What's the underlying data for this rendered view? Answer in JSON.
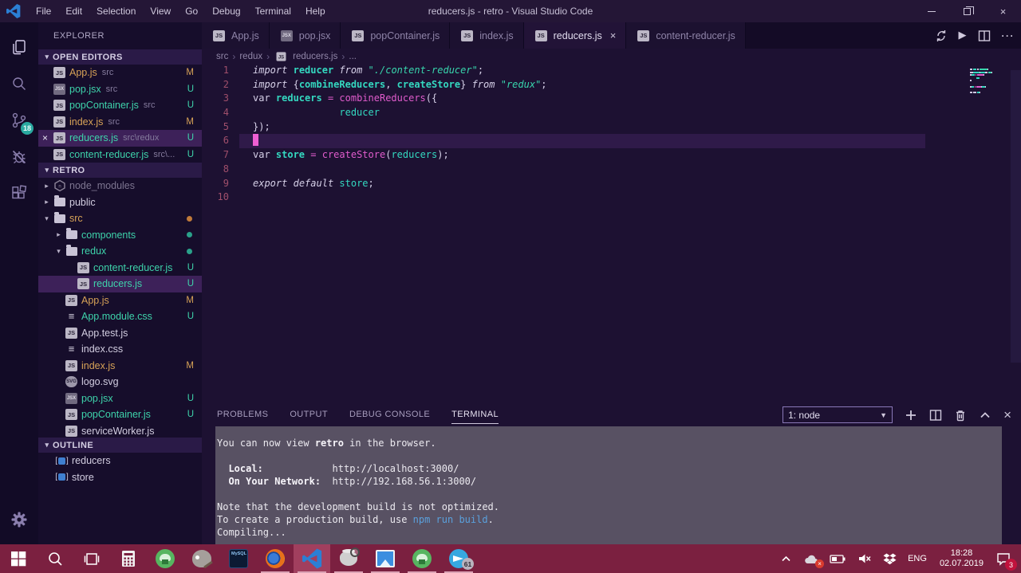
{
  "title_bar": {
    "title": "reducers.js - retro - Visual Studio Code",
    "menus": [
      "File",
      "Edit",
      "Selection",
      "View",
      "Go",
      "Debug",
      "Terminal",
      "Help"
    ]
  },
  "activity_bar": {
    "items": [
      {
        "icon": "files",
        "name": "explorer",
        "active": true
      },
      {
        "icon": "search",
        "name": "search"
      },
      {
        "icon": "source-control",
        "name": "source-control",
        "badge": "18"
      },
      {
        "icon": "debug",
        "name": "debug"
      },
      {
        "icon": "extensions",
        "name": "extensions"
      }
    ],
    "bottom_icon": "settings-gear"
  },
  "sidebar": {
    "title": "EXPLORER",
    "open_editors": {
      "header": "OPEN EDITORS",
      "items": [
        {
          "label": "App.js",
          "desc": "src",
          "icon": "js",
          "color": "modified",
          "badge": "M"
        },
        {
          "label": "pop.jsx",
          "desc": "src",
          "icon": "jsx",
          "color": "untracked",
          "badge": "U"
        },
        {
          "label": "popContainer.js",
          "desc": "src",
          "icon": "js",
          "color": "untracked",
          "badge": "U"
        },
        {
          "label": "index.js",
          "desc": "src",
          "icon": "js",
          "color": "modified",
          "badge": "M"
        },
        {
          "label": "reducers.js",
          "desc": "src\\redux",
          "icon": "js",
          "color": "untracked",
          "badge": "U",
          "selected": true,
          "close": true
        },
        {
          "label": "content-reducer.js",
          "desc": "src\\...",
          "icon": "js",
          "color": "untracked",
          "badge": "U"
        }
      ]
    },
    "project": {
      "header": "RETRO",
      "items": [
        {
          "label": "node_modules",
          "level": 1,
          "icon": "npm",
          "arrow": "right",
          "color": "muted"
        },
        {
          "label": "public",
          "level": 1,
          "icon": "folder",
          "arrow": "right",
          "color": "default"
        },
        {
          "label": "src",
          "level": 1,
          "icon": "folder",
          "arrow": "down",
          "color": "modified",
          "dot": "#c07a3a"
        },
        {
          "label": "components",
          "level": 2,
          "icon": "folder",
          "arrow": "right",
          "color": "untracked",
          "dot": "#2aa18a"
        },
        {
          "label": "redux",
          "level": 2,
          "icon": "folder",
          "arrow": "down",
          "color": "untracked",
          "dot": "#2aa18a"
        },
        {
          "label": "content-reducer.js",
          "level": 3,
          "icon": "js",
          "color": "untracked",
          "badge": "U"
        },
        {
          "label": "reducers.js",
          "level": 3,
          "icon": "js",
          "color": "untracked",
          "badge": "U",
          "selected": true
        },
        {
          "label": "App.js",
          "level": 2,
          "icon": "js",
          "color": "modified",
          "badge": "M"
        },
        {
          "label": "App.module.css",
          "level": 2,
          "icon": "css",
          "color": "untracked",
          "badge": "U"
        },
        {
          "label": "App.test.js",
          "level": 2,
          "icon": "js",
          "color": "default"
        },
        {
          "label": "index.css",
          "level": 2,
          "icon": "css",
          "color": "default"
        },
        {
          "label": "index.js",
          "level": 2,
          "icon": "js",
          "color": "modified",
          "badge": "M"
        },
        {
          "label": "logo.svg",
          "level": 2,
          "icon": "svg",
          "color": "default"
        },
        {
          "label": "pop.jsx",
          "level": 2,
          "icon": "jsx",
          "color": "untracked",
          "badge": "U"
        },
        {
          "label": "popContainer.js",
          "level": 2,
          "icon": "js",
          "color": "untracked",
          "badge": "U"
        },
        {
          "label": "serviceWorker.js",
          "level": 2,
          "icon": "js",
          "color": "default"
        }
      ]
    },
    "outline": {
      "header": "OUTLINE",
      "items": [
        {
          "label": "reducers",
          "icon": "variable"
        },
        {
          "label": "store",
          "icon": "variable"
        }
      ]
    }
  },
  "editor": {
    "tabs": [
      {
        "label": "App.js",
        "icon": "js"
      },
      {
        "label": "pop.jsx",
        "icon": "jsx"
      },
      {
        "label": "popContainer.js",
        "icon": "js"
      },
      {
        "label": "index.js",
        "icon": "js"
      },
      {
        "label": "reducers.js",
        "icon": "js",
        "active": true,
        "close": true
      },
      {
        "label": "content-reducer.js",
        "icon": "js"
      }
    ],
    "actions": [
      "sync",
      "run",
      "split-editor",
      "more"
    ],
    "breadcrumb": [
      {
        "label": "src"
      },
      {
        "label": "redux"
      },
      {
        "label": "reducers.js",
        "icon": "js"
      },
      {
        "label": "..."
      }
    ],
    "code_lines": [
      {
        "n": "1",
        "tokens": [
          [
            "import",
            "kw"
          ],
          [
            " ",
            "pl"
          ],
          [
            "reducer",
            "id"
          ],
          [
            " ",
            "pl"
          ],
          [
            "from",
            "kw"
          ],
          [
            " ",
            "pl"
          ],
          [
            "\"./content-reducer\"",
            "str"
          ],
          [
            ";",
            "pl"
          ]
        ]
      },
      {
        "n": "2",
        "tokens": [
          [
            "import",
            "kw"
          ],
          [
            " {",
            "pl"
          ],
          [
            "combineReducers",
            "id"
          ],
          [
            ", ",
            "pl"
          ],
          [
            "createStore",
            "id"
          ],
          [
            "} ",
            "pl"
          ],
          [
            "from",
            "kw"
          ],
          [
            " ",
            "pl"
          ],
          [
            "\"redux\"",
            "str"
          ],
          [
            ";",
            "pl"
          ]
        ]
      },
      {
        "n": "3",
        "tokens": [
          [
            "var ",
            "pl"
          ],
          [
            "reducers",
            "id"
          ],
          [
            " ",
            "pl"
          ],
          [
            "=",
            "op"
          ],
          [
            " ",
            "pl"
          ],
          [
            "combineReducers",
            "fn"
          ],
          [
            "({",
            "pl"
          ]
        ]
      },
      {
        "n": "4",
        "tokens": [
          [
            "               ",
            "pl"
          ],
          [
            "reducer",
            "idp"
          ]
        ]
      },
      {
        "n": "5",
        "tokens": [
          [
            "});",
            "pl"
          ]
        ]
      },
      {
        "n": "6",
        "tokens": [],
        "current": true,
        "cursor": true
      },
      {
        "n": "7",
        "tokens": [
          [
            "var ",
            "pl"
          ],
          [
            "store",
            "id"
          ],
          [
            " ",
            "pl"
          ],
          [
            "=",
            "op"
          ],
          [
            " ",
            "pl"
          ],
          [
            "createStore",
            "fn"
          ],
          [
            "(",
            "pl"
          ],
          [
            "reducers",
            "idp"
          ],
          [
            ");",
            "pl"
          ]
        ]
      },
      {
        "n": "8",
        "tokens": []
      },
      {
        "n": "9",
        "tokens": [
          [
            "export",
            "kw"
          ],
          [
            " ",
            "pl"
          ],
          [
            "default",
            "kw"
          ],
          [
            " ",
            "pl"
          ],
          [
            "store",
            "idp"
          ],
          [
            ";",
            "pl"
          ]
        ]
      },
      {
        "n": "10",
        "tokens": []
      }
    ]
  },
  "panel": {
    "tabs": [
      {
        "label": "PROBLEMS"
      },
      {
        "label": "OUTPUT"
      },
      {
        "label": "DEBUG CONSOLE"
      },
      {
        "label": "TERMINAL",
        "active": true
      }
    ],
    "terminal_select": "1: node",
    "actions": [
      "new-terminal",
      "split-terminal",
      "kill-terminal",
      "maximize-panel",
      "close-panel"
    ],
    "terminal_lines": [
      [
        [
          "You can now view ",
          "t"
        ],
        [
          "retro",
          "b"
        ],
        [
          " in the browser.",
          "t"
        ]
      ],
      [],
      [
        [
          "  ",
          "t"
        ],
        [
          "Local:",
          "b"
        ],
        [
          "            ",
          "t"
        ],
        [
          "http://localhost:3000/",
          "t"
        ]
      ],
      [
        [
          "  ",
          "t"
        ],
        [
          "On Your Network:",
          "b"
        ],
        [
          "  ",
          "t"
        ],
        [
          "http://192.168.56.1:3000/",
          "t"
        ]
      ],
      [],
      [
        [
          "Note that the development build is not optimized.",
          "t"
        ]
      ],
      [
        [
          "To create a production build, use ",
          "t"
        ],
        [
          "npm run build",
          "c"
        ],
        [
          ".",
          "t"
        ]
      ],
      [
        [
          "Compiling...",
          "t"
        ]
      ]
    ]
  },
  "taskbar": {
    "apps": [
      {
        "icon": "windows-start",
        "name": "start-button"
      },
      {
        "icon": "taskbar-search",
        "name": "taskbar-search"
      },
      {
        "icon": "task-view",
        "name": "task-view"
      },
      {
        "icon": "calculator",
        "name": "calculator"
      },
      {
        "icon": "gitkraken",
        "name": "gitkraken"
      },
      {
        "icon": "gimp",
        "name": "gimp"
      },
      {
        "icon": "mysql",
        "name": "mysql-terminal"
      },
      {
        "icon": "firefox",
        "name": "firefox",
        "running": true
      },
      {
        "icon": "vscode",
        "name": "vscode",
        "active": true,
        "running": true
      },
      {
        "icon": "db-tool",
        "name": "database-tool",
        "running": true
      },
      {
        "icon": "photos",
        "name": "photos",
        "running": true
      },
      {
        "icon": "gitkraken",
        "name": "gitkraken-2",
        "running": true
      },
      {
        "icon": "telegram",
        "name": "telegram",
        "running": true,
        "badge": "61"
      }
    ],
    "tray": {
      "language": "ENG",
      "time": "18:28",
      "date": "02.07.2019",
      "notification_badge": "3"
    }
  },
  "colors": {
    "accent_teal": "#34d8c0",
    "accent_pink": "#e05ccc",
    "modified_orange": "#d7a257",
    "untracked_green": "#3ed3ab",
    "editor_bg": "#1d1132",
    "sidebar_bg": "#160d2b",
    "terminal_bg": "#585163",
    "taskbar_red": "#7b2040",
    "scm_badge": "#2aa9a0",
    "cursor_pink": "#ee5fd2",
    "link_blue": "#5aa0dc"
  }
}
